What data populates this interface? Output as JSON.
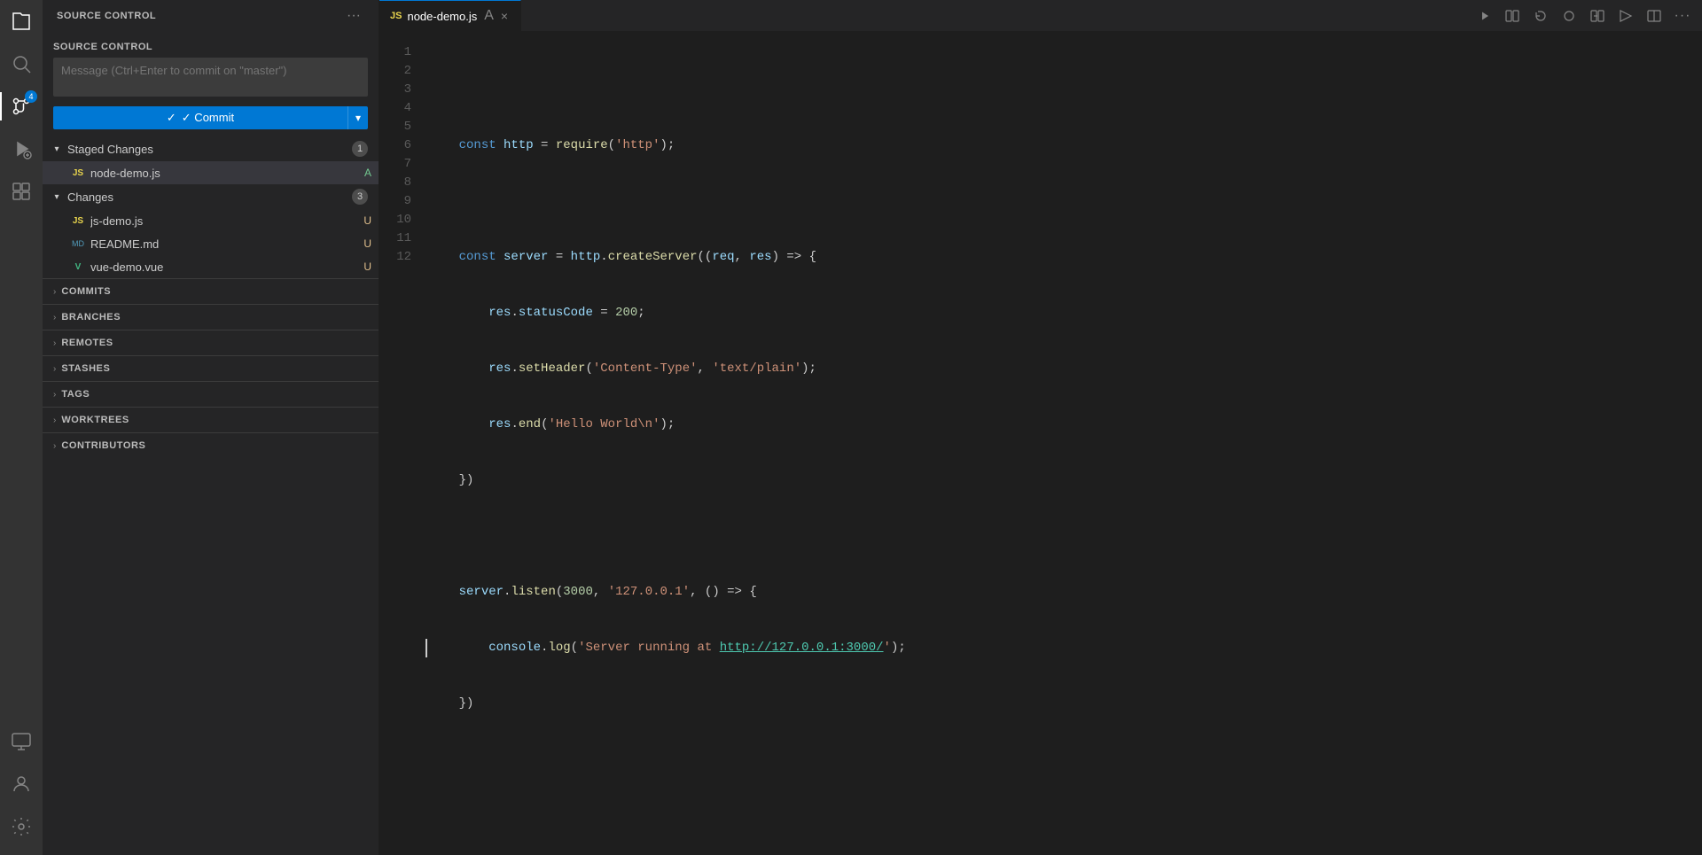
{
  "activityBar": {
    "icons": [
      {
        "name": "explorer-icon",
        "symbol": "⬜",
        "tooltip": "Explorer",
        "active": false
      },
      {
        "name": "search-icon",
        "symbol": "🔍",
        "tooltip": "Search",
        "active": false
      },
      {
        "name": "source-control-icon",
        "symbol": "⑂",
        "tooltip": "Source Control",
        "active": true,
        "badge": "4"
      },
      {
        "name": "run-icon",
        "symbol": "▷",
        "tooltip": "Run",
        "active": false
      },
      {
        "name": "extensions-icon",
        "symbol": "⧉",
        "tooltip": "Extensions",
        "active": false
      }
    ],
    "bottomIcons": [
      {
        "name": "remote-icon",
        "symbol": "⚡",
        "tooltip": "Remote"
      },
      {
        "name": "account-icon",
        "symbol": "👤",
        "tooltip": "Account"
      },
      {
        "name": "settings-icon",
        "symbol": "⚙",
        "tooltip": "Settings"
      }
    ]
  },
  "sidebar": {
    "title": "SOURCE CONTROL",
    "moreActionsLabel": "···",
    "scSectionTitle": "SOURCE CONTROL",
    "commitPlaceholder": "Message (Ctrl+Enter to commit on \"master\")",
    "commitLabel": "✓ Commit",
    "commitChevron": "⌄",
    "stagedChanges": {
      "label": "Staged Changes",
      "count": "1",
      "expanded": true,
      "files": [
        {
          "name": "node-demo.js",
          "icon": "js",
          "iconLabel": "JS",
          "status": "A",
          "statusType": "added"
        }
      ]
    },
    "changes": {
      "label": "Changes",
      "count": "3",
      "expanded": true,
      "files": [
        {
          "name": "js-demo.js",
          "icon": "js",
          "iconLabel": "JS",
          "status": "U",
          "statusType": "untracked"
        },
        {
          "name": "README.md",
          "icon": "md",
          "iconLabel": "MD",
          "status": "U",
          "statusType": "untracked"
        },
        {
          "name": "vue-demo.vue",
          "icon": "vue",
          "iconLabel": "V",
          "status": "U",
          "statusType": "untracked"
        }
      ]
    }
  },
  "bottomSections": [
    {
      "name": "commits-section",
      "label": "COMMITS"
    },
    {
      "name": "branches-section",
      "label": "BRANCHES"
    },
    {
      "name": "remotes-section",
      "label": "REMOTES"
    },
    {
      "name": "stashes-section",
      "label": "STASHES"
    },
    {
      "name": "tags-section",
      "label": "TAGS"
    },
    {
      "name": "worktrees-section",
      "label": "WORKTREES"
    },
    {
      "name": "contributors-section",
      "label": "CONTRIBUTORS"
    }
  ],
  "editor": {
    "tabs": [
      {
        "name": "node-demo-tab",
        "label": "node-demo.js",
        "icon": "JS",
        "active": true,
        "modified": true
      }
    ],
    "toolbarIcons": [
      {
        "name": "run-debug-icon",
        "symbol": "▷"
      },
      {
        "name": "split-editor-icon",
        "symbol": "⧉"
      },
      {
        "name": "revert-icon",
        "symbol": "↺"
      },
      {
        "name": "stage-icon",
        "symbol": "○"
      },
      {
        "name": "diff-icon",
        "symbol": "⊡"
      },
      {
        "name": "open-changes-icon",
        "symbol": "⬡"
      },
      {
        "name": "split-horizontal-icon",
        "symbol": "⬜"
      },
      {
        "name": "more-icon",
        "symbol": "···"
      }
    ],
    "code": {
      "lines": [
        {
          "num": 1,
          "content": ""
        },
        {
          "num": 2,
          "content": "    const http = require('http');"
        },
        {
          "num": 3,
          "content": ""
        },
        {
          "num": 4,
          "content": "    const server = http.createServer((req, res) => {"
        },
        {
          "num": 5,
          "content": "        res.statusCode = 200;"
        },
        {
          "num": 6,
          "content": "        res.setHeader('Content-Type', 'text/plain');"
        },
        {
          "num": 7,
          "content": "        res.end('Hello World\\n');"
        },
        {
          "num": 8,
          "content": "    })"
        },
        {
          "num": 9,
          "content": ""
        },
        {
          "num": 10,
          "content": "    server.listen(3000, '127.0.0.1', () => {"
        },
        {
          "num": 11,
          "content": "        console.log('Server running at http://127.0.0.1:3000/');"
        },
        {
          "num": 12,
          "content": "    })"
        }
      ]
    }
  }
}
